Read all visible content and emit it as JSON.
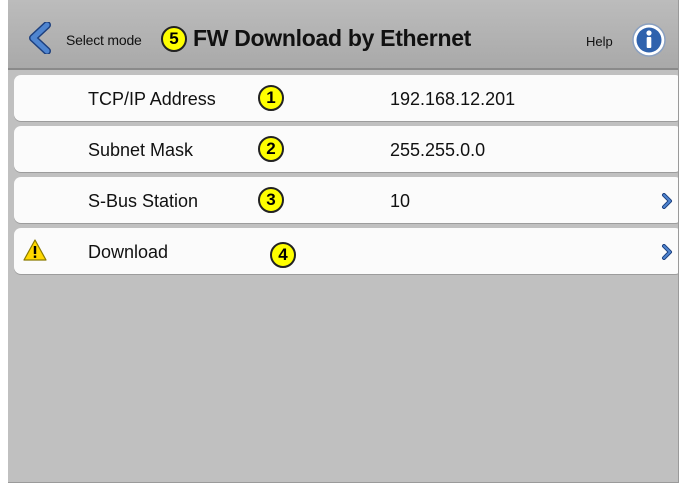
{
  "header": {
    "select_mode": "Select mode",
    "title": "FW Download by Ethernet",
    "help": "Help",
    "title_callout": "5"
  },
  "rows": [
    {
      "label": "TCP/IP Address",
      "value": "192.168.12.201",
      "callout": "1"
    },
    {
      "label": "Subnet Mask",
      "value": "255.255.0.0",
      "callout": "2"
    },
    {
      "label": "S-Bus Station",
      "value": "10",
      "callout": "3"
    },
    {
      "label": "Download",
      "value": "",
      "callout": "4"
    }
  ],
  "colors": {
    "background": "#c0c0c0",
    "accent": "#2c5fa8",
    "callout": "#ffff00",
    "warning": "#ffd800"
  },
  "icons": [
    "back-chevron-icon",
    "info-icon",
    "chevron-right-icon",
    "warning-icon"
  ]
}
